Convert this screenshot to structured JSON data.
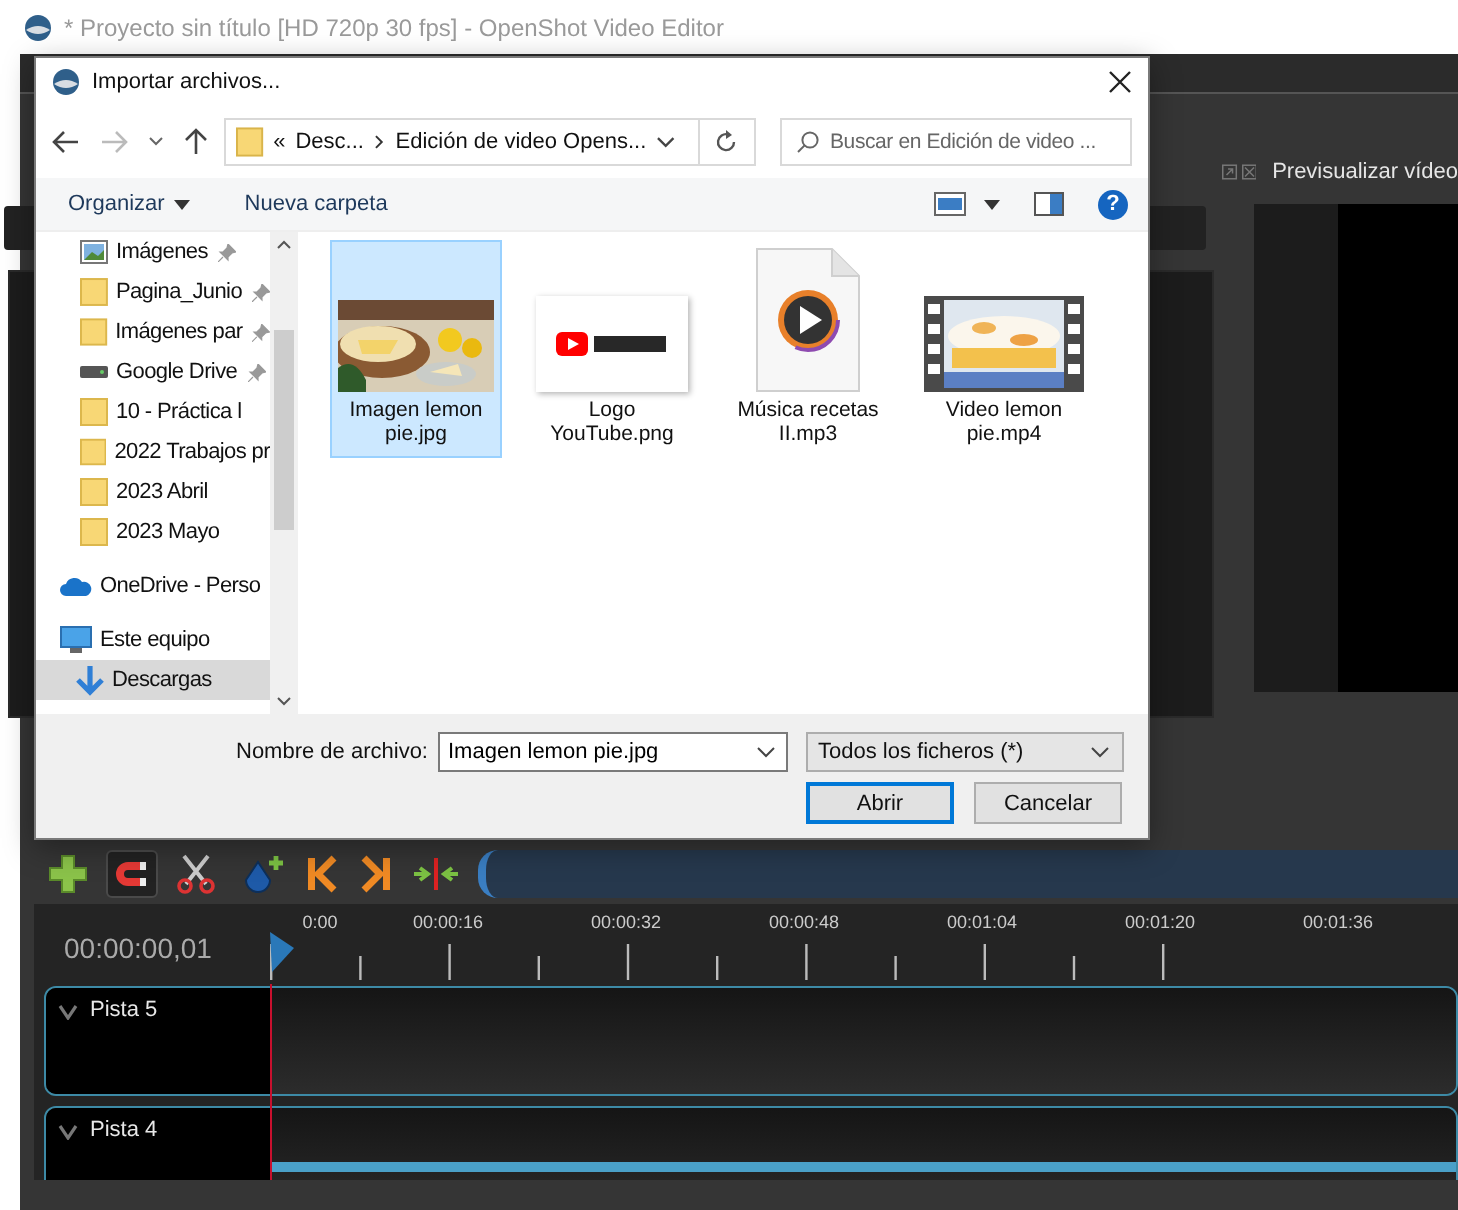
{
  "window": {
    "title": "* Proyecto sin título [HD 720p 30 fps] - OpenShot Video Editor"
  },
  "preview": {
    "title": "Previsualizar vídeo"
  },
  "toolbar": {
    "snapping": true
  },
  "timeline": {
    "timecode": "00:00:00,01",
    "ruler_labels": [
      "0:00",
      "00:00:16",
      "00:00:32",
      "00:00:48",
      "00:01:04",
      "00:01:20",
      "00:01:36"
    ],
    "tracks": [
      {
        "name": "Pista 5",
        "clip": false
      },
      {
        "name": "Pista 4",
        "clip": true
      }
    ]
  },
  "dialog": {
    "title": "Importar archivos...",
    "back_enabled": true,
    "forward_enabled": false,
    "address": {
      "overflow": "«",
      "parts": [
        "Desc...",
        "Edición de video Opens..."
      ]
    },
    "search": {
      "placeholder": "Buscar en Edición de video ..."
    },
    "commands": {
      "organize": "Organizar",
      "new_folder": "Nueva carpeta",
      "help": "?"
    },
    "quick_access": [
      {
        "label": "Imágenes",
        "kind": "pictures",
        "pinned": true,
        "selected": false
      },
      {
        "label": "Pagina_Junio",
        "kind": "folder",
        "pinned": true,
        "selected": false
      },
      {
        "label": "Imágenes par",
        "kind": "folder",
        "pinned": true,
        "selected": false
      },
      {
        "label": "Google Drive",
        "kind": "drive",
        "pinned": true,
        "selected": false
      },
      {
        "label": "10 - Práctica l",
        "kind": "folder",
        "pinned": false,
        "selected": false
      },
      {
        "label": "2022 Trabajos pr",
        "kind": "folder",
        "pinned": false,
        "selected": false
      },
      {
        "label": "2023 Abril",
        "kind": "folder",
        "pinned": false,
        "selected": false
      },
      {
        "label": "2023 Mayo",
        "kind": "folder",
        "pinned": false,
        "selected": false
      }
    ],
    "locations": [
      {
        "label": "OneDrive - Perso",
        "kind": "cloud",
        "selected": false
      },
      {
        "label": "Este equipo",
        "kind": "computer",
        "selected": false,
        "children": [
          {
            "label": "Descargas",
            "kind": "downloads",
            "selected": true
          }
        ]
      }
    ],
    "files": [
      {
        "name": "Imagen lemon pie.jpg",
        "selected": true
      },
      {
        "name": "Logo YouTube.png",
        "kind": "logo",
        "selected": false
      },
      {
        "name": "Música recetas II.mp3",
        "kind": "audio",
        "selected": false
      },
      {
        "name": "Video lemon pie.mp4",
        "kind": "video",
        "selected": false
      }
    ],
    "filename_label": "Nombre de archivo:",
    "filename": "Imagen lemon pie.jpg",
    "file_type": "Todos los ficheros (*)",
    "buttons": [
      {
        "label": "Abrir",
        "default": true
      },
      {
        "label": "Cancelar",
        "default": false
      }
    ]
  }
}
